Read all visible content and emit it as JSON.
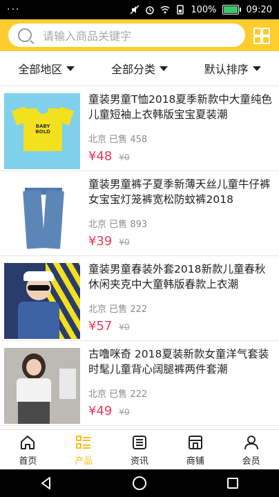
{
  "status_bar": {
    "dots": "···",
    "battery_percent": "100%",
    "time": "09:20"
  },
  "search": {
    "placeholder": "请输入商品关键字"
  },
  "filters": [
    {
      "label": "全部地区"
    },
    {
      "label": "全部分类"
    },
    {
      "label": "默认排序"
    }
  ],
  "products": [
    {
      "title": "童装男童T恤2018夏季新款中大童纯色儿童短袖上衣韩版宝宝夏装潮",
      "location": "北京",
      "sold_label": "已售",
      "sold": "458",
      "price": "¥48",
      "original_price": "¥0",
      "thumb_text": "BABY BOLD"
    },
    {
      "title": "童装男童裤子夏季新薄天丝儿童牛仔裤女宝宝灯笼裤宽松防蚊裤2018",
      "location": "北京",
      "sold_label": "已售",
      "sold": "893",
      "price": "¥39",
      "original_price": "¥0"
    },
    {
      "title": "童装男童春装外套2018新款儿童春秋休闲夹克中大童韩版春款上衣潮",
      "location": "北京",
      "sold_label": "已售",
      "sold": "222",
      "price": "¥57",
      "original_price": "¥0"
    },
    {
      "title": "古噜咪奇 2018夏装新款女童洋气套装时髦儿童背心阔腿裤两件套潮",
      "location": "北京",
      "sold_label": "已售",
      "sold": "222",
      "price": "¥49",
      "original_price": "¥0"
    }
  ],
  "bottom_nav": [
    {
      "label": "首页",
      "icon": "home-icon"
    },
    {
      "label": "产品",
      "icon": "products-icon",
      "active": true
    },
    {
      "label": "资讯",
      "icon": "news-icon"
    },
    {
      "label": "商铺",
      "icon": "shop-icon"
    },
    {
      "label": "会员",
      "icon": "member-icon"
    }
  ],
  "colors": {
    "accent": "#ffcc2e",
    "active_tab": "#ffbb17",
    "price": "#e8385b"
  }
}
